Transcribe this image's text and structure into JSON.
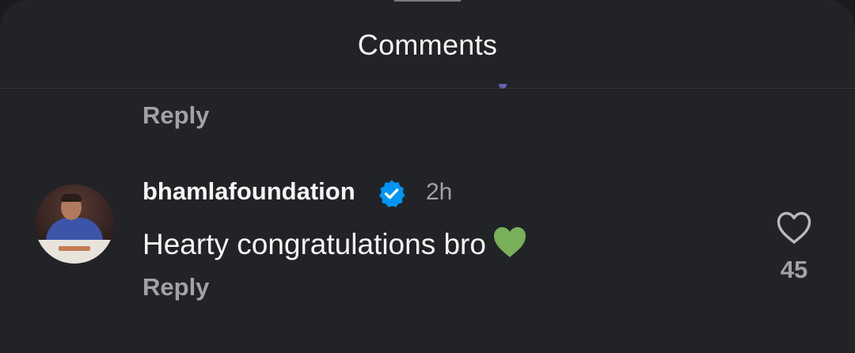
{
  "sheet": {
    "title": "Comments"
  },
  "previous_comment": {
    "reply_label": "Reply"
  },
  "comment": {
    "avatar_icon": "profile-photo",
    "username": "bhamlafoundation",
    "verified_icon": "verified-badge-icon",
    "timestamp": "2h",
    "text": "Hearty congratulations bro",
    "emoji_icon": "green-heart-emoji",
    "reply_label": "Reply",
    "like_icon": "heart-outline-icon",
    "like_count": "45"
  },
  "colors": {
    "background": "#222327",
    "text_primary": "#f5f5f5",
    "text_secondary": "#a1a2a7",
    "verified_blue": "#0095f6",
    "emoji_green": "#78b159"
  }
}
